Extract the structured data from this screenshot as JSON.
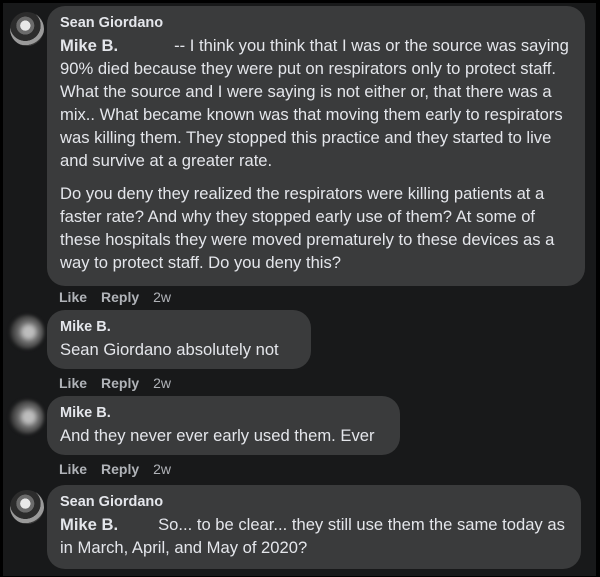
{
  "comments": [
    {
      "author": "Sean Giordano",
      "mention": "Mike B.",
      "paragraphs": [
        "-- I think you think that I was or the source was saying 90% died because they were put on respirators only to protect staff. What the source and I were saying is not either or, that there was a mix.. What became known was that moving them early to respirators was killing them. They stopped this practice and they started to live and survive at a greater rate.",
        "Do you deny they realized the respirators were killing patients at a faster rate? And why they stopped early use of them? At some of these hospitals they were moved prematurely to these devices as a way to protect staff. Do you deny this?"
      ],
      "like": "Like",
      "reply": "Reply",
      "time": "2w"
    },
    {
      "author": "Mike B.",
      "mention": "Sean Giordano",
      "text": "absolutely not",
      "like": "Like",
      "reply": "Reply",
      "time": "2w"
    },
    {
      "author": "Mike B.",
      "text": "And they never ever early used them. Ever",
      "like": "Like",
      "reply": "Reply",
      "time": "2w"
    },
    {
      "author": "Sean Giordano",
      "mention": "Mike B.",
      "text": "So... to be clear... they still use them the same today as in March, April, and May of 2020?"
    }
  ],
  "colors": {
    "background": "#18191a",
    "bubble": "#3a3b3c",
    "text": "#e4e6eb",
    "meta": "#b0b3b8"
  }
}
